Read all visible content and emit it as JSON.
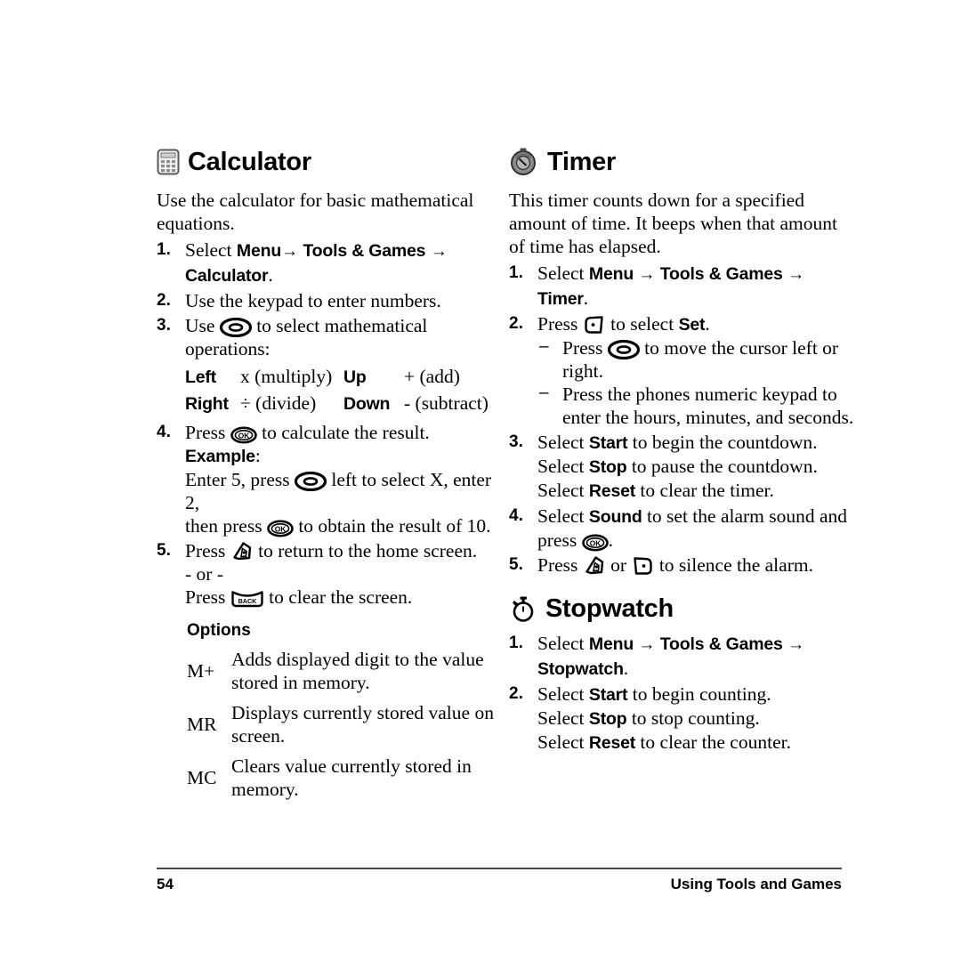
{
  "page": {
    "number": "54",
    "footer_title": "Using Tools and Games"
  },
  "calculator": {
    "icon": "calculator-icon",
    "title": "Calculator",
    "intro": "Use the calculator for basic mathematical equations.",
    "steps": [
      {
        "num": "1.",
        "pre": "Select ",
        "b1": "Menu",
        "arrow1": "→",
        "b2": "Tools & Games",
        "arrow2": "→",
        "b3": "Calculator",
        "post": "."
      },
      {
        "num": "2.",
        "text": "Use the keypad to enter numbers."
      },
      {
        "num": "3.",
        "pre": "Use ",
        "icon": "navigation-rocker-key-icon",
        "post": " to select mathematical operations:"
      },
      {
        "num": "4.",
        "pre": "Press ",
        "icon": "ok-key-icon",
        "mid": " to calculate the result. ",
        "bold": "Example",
        "colon": ":",
        "line2_pre": "Enter 5, press ",
        "line2_icon": "navigation-rocker-key-icon",
        "line2_post": " left to select X, enter 2,",
        "line3_pre": "then press ",
        "line3_icon": "ok-key-icon",
        "line3_post": " to obtain the result of 10."
      },
      {
        "num": "5.",
        "pre": "Press ",
        "icon": "end-key-icon",
        "post": " to return to the home screen.",
        "or": "- or -",
        "alt_pre": "Press ",
        "alt_icon": "back-key-icon",
        "alt_post": " to clear the screen."
      }
    ],
    "operations": [
      {
        "key": "Left",
        "value": "x (multiply)",
        "key2": "Up",
        "value2": "+ (add)"
      },
      {
        "key": "Right",
        "value": "÷ (divide)",
        "key2": "Down",
        "value2": "- (subtract)"
      }
    ],
    "options_heading": "Options",
    "options": [
      {
        "key": "M+",
        "desc": "Adds displayed digit to the value stored in memory."
      },
      {
        "key": "MR",
        "desc": "Displays currently stored value on screen."
      },
      {
        "key": "MC",
        "desc": "Clears value currently stored in memory."
      }
    ]
  },
  "timer": {
    "icon": "timer-icon",
    "title": "Timer",
    "intro": "This timer counts down for a specified amount of time. It beeps when that amount of time has elapsed.",
    "steps": [
      {
        "num": "1.",
        "pre": "Select ",
        "b1": "Menu",
        "arrow1": "→",
        "b2": "Tools & Games",
        "arrow2": "→",
        "b3": "Timer",
        "post": "."
      },
      {
        "num": "2.",
        "pre": "Press ",
        "icon": "left-softkey-icon",
        "mid": " to select ",
        "bold": "Set",
        "post": ".",
        "dashes": [
          {
            "dash": "–",
            "pre": "Press ",
            "icon": "navigation-rocker-key-icon",
            "post": " to move the cursor left or right."
          },
          {
            "dash": "–",
            "text": "Press the phones numeric keypad to enter the hours, minutes, and seconds."
          }
        ]
      },
      {
        "num": "3.",
        "lines": [
          {
            "pre": "Select ",
            "bold": "Start",
            "post": " to begin the countdown."
          },
          {
            "pre": "Select ",
            "bold": "Stop",
            "post": " to pause the countdown."
          },
          {
            "pre": "Select ",
            "bold": "Reset",
            "post": " to clear the timer."
          }
        ]
      },
      {
        "num": "4.",
        "pre": "Select ",
        "bold": "Sound",
        "mid": " to set the alarm sound and",
        "line2_pre": "press ",
        "line2_icon": "ok-key-icon",
        "line2_post": "."
      },
      {
        "num": "5.",
        "pre": "Press ",
        "icon": "end-key-icon",
        "mid": " or ",
        "icon2": "right-softkey-icon",
        "post": " to silence the alarm."
      }
    ]
  },
  "stopwatch": {
    "icon": "stopwatch-icon",
    "title": "Stopwatch",
    "steps": [
      {
        "num": "1.",
        "pre": "Select ",
        "b1": "Menu",
        "arrow1": "→",
        "b2": "Tools & Games",
        "arrow2": "→",
        "b3": "Stopwatch",
        "post": "."
      },
      {
        "num": "2.",
        "lines": [
          {
            "pre": "Select ",
            "bold": "Start",
            "post": " to begin counting."
          },
          {
            "pre": "Select ",
            "bold": "Stop",
            "post": " to stop counting."
          },
          {
            "pre": "Select ",
            "bold": "Reset",
            "post": " to clear the counter."
          }
        ]
      }
    ]
  },
  "colors": {
    "text": "#000000",
    "rule": "#4a4a4a",
    "icon_grey": "#8c8c8c",
    "icon_dark": "#3a3a3a"
  }
}
